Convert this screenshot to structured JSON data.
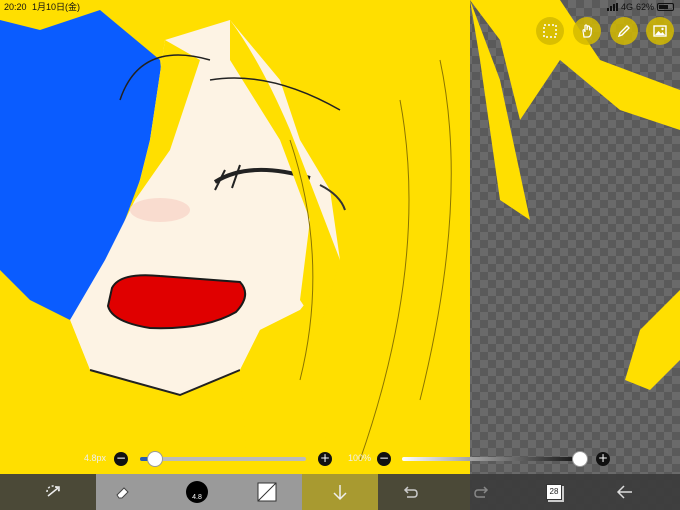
{
  "status_bar": {
    "time": "20:20",
    "date": "1月10日(金)",
    "network": "4G",
    "battery": "62%"
  },
  "top_tools": [
    {
      "name": "selection-icon"
    },
    {
      "name": "hand-icon"
    },
    {
      "name": "pen-icon"
    },
    {
      "name": "image-icon"
    }
  ],
  "sliders": {
    "brush_size_label": "4.8px",
    "brush_size_fraction": 0.09,
    "opacity_label": "100%",
    "opacity_fraction": 1.0
  },
  "toolbar": {
    "brush_size_badge": "4.8",
    "layers_count": "28"
  },
  "colors": {
    "hair": "#ffdf00",
    "background_blue": "#0a5cff",
    "mouth": "#e00000",
    "skin": "#fdf3e4",
    "toolbar_bg": "#3c3c3c",
    "tool_button_bg": "#d4ba00"
  }
}
